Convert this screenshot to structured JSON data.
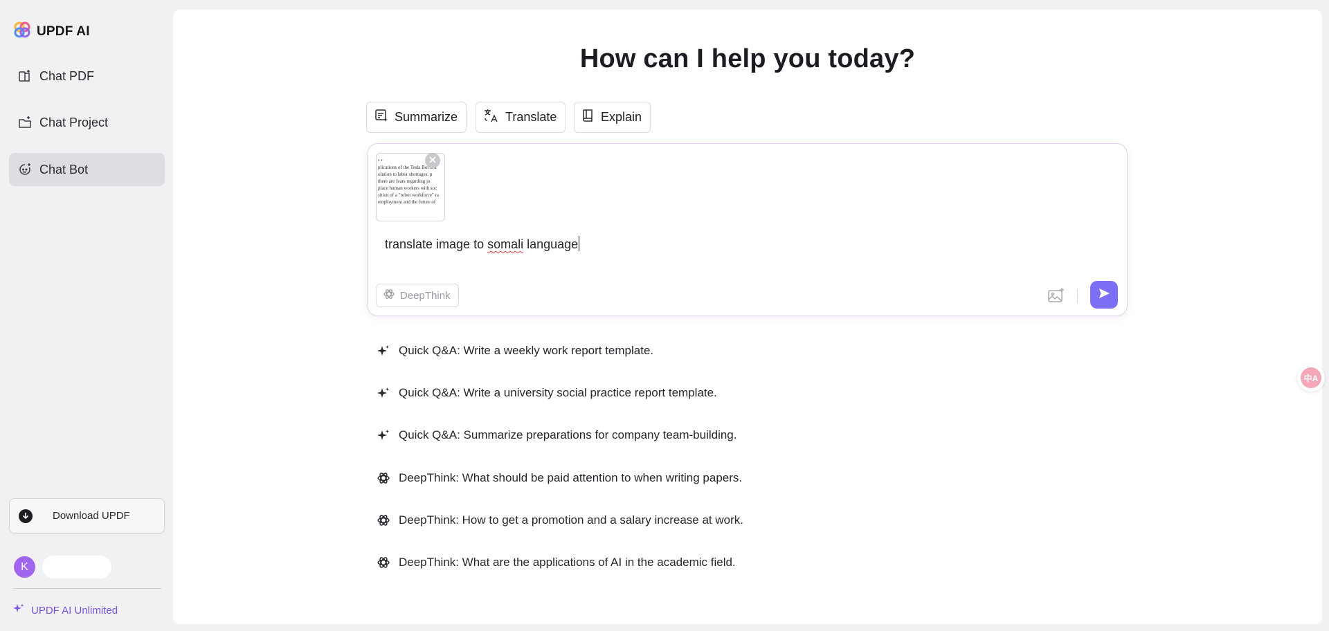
{
  "app": {
    "brand_name": "UPDF AI",
    "accent_color": "#7c6ff5",
    "logo_icon": "updf-flower-logo"
  },
  "sidebar": {
    "items": [
      {
        "label": "Chat PDF",
        "icon": "chat-pdf-icon",
        "active": false
      },
      {
        "label": "Chat Project",
        "icon": "chat-project-icon",
        "active": false
      },
      {
        "label": "Chat Bot",
        "icon": "chat-bot-icon",
        "active": true
      }
    ],
    "download_label": "Download UPDF",
    "user_initial": "K",
    "unlimited_label": "UPDF AI Unlimited"
  },
  "main": {
    "headline": "How can I help you today?",
    "chips": [
      {
        "label": "Summarize",
        "icon": "summarize-icon"
      },
      {
        "label": "Translate",
        "icon": "translate-icon"
      },
      {
        "label": "Explain",
        "icon": "book-icon"
      }
    ],
    "composer": {
      "prompt_before": "translate image to ",
      "prompt_misspelled": "somali",
      "prompt_after": " language",
      "deepthink_label": "DeepThink",
      "attachment_lines": [
        "• •",
        "plications of the Tesla Bot is a",
        "olution to labor shortages. p",
        " there are fears regarding jo",
        "place human workers with soc",
        "sition of a \"robot workforce\" ra",
        "employment and the future of"
      ]
    },
    "suggestions": [
      {
        "type": "quick",
        "icon": "sparkle-icon",
        "text": "Quick Q&A: Write a weekly work report template."
      },
      {
        "type": "quick",
        "icon": "sparkle-icon",
        "text": "Quick Q&A: Write a university social practice report template."
      },
      {
        "type": "quick",
        "icon": "sparkle-icon",
        "text": "Quick Q&A: Summarize preparations for company team-building."
      },
      {
        "type": "deep",
        "icon": "deepthink-icon",
        "text": "DeepThink: What should be paid attention to when writing papers."
      },
      {
        "type": "deep",
        "icon": "deepthink-icon",
        "text": "DeepThink: How to get a promotion and a salary increase at work."
      },
      {
        "type": "deep",
        "icon": "deepthink-icon",
        "text": "DeepThink: What are the applications of AI in the academic field."
      }
    ]
  },
  "floating": {
    "translate_glyph": "中A"
  }
}
